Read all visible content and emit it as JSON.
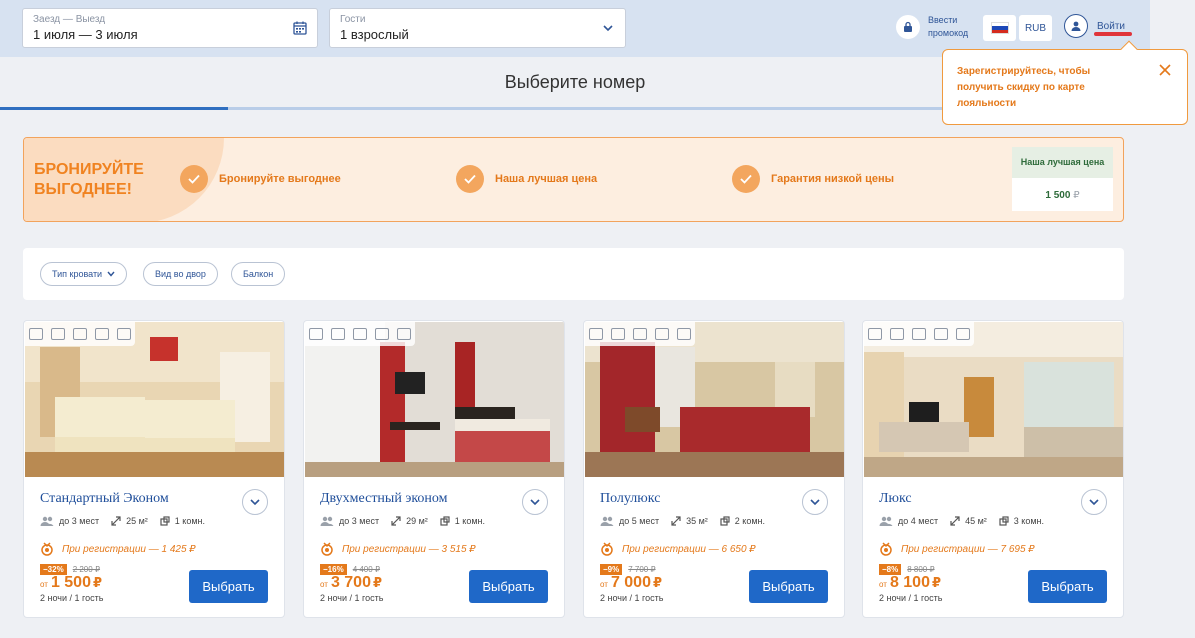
{
  "search": {
    "dates_label": "Заезд — Выезд",
    "dates_value": "1 июля — 3 июля",
    "guests_label": "Гости",
    "guests_value": "1 взрослый"
  },
  "header": {
    "promo_line1": "Ввести",
    "promo_line2": "промокод",
    "currency": "RUB",
    "login_label": "Войти"
  },
  "tooltip": {
    "text": "Зарегистрируйтесь, чтобы получить скидку по карте лояльности"
  },
  "page": {
    "title": "Выберите номер"
  },
  "banner": {
    "headline_line1": "БРОНИРУЙТЕ",
    "headline_line2": "ВЫГОДНЕЕ!",
    "items": [
      {
        "label": "Бронируйте выгоднее"
      },
      {
        "label": "Наша лучшая цена"
      },
      {
        "label": "Гарантия низкой цены"
      }
    ],
    "best_price_title": "Наша лучшая цена",
    "best_price_value": "1 500",
    "best_price_currency": "₽"
  },
  "filters": [
    {
      "label": "Тип кровати"
    },
    {
      "label": "Вид во двор"
    },
    {
      "label": "Балкон"
    }
  ],
  "rooms": [
    {
      "name": "Стандартный Эконом",
      "guests": "до 3 мест",
      "area": "25 м²",
      "rooms": "1 комн.",
      "reg_text": "При регистрации — 1 425 ₽",
      "discount": "−32%",
      "old_price": "2 200 ₽",
      "from": "от",
      "price": "1 500",
      "currency": "₽",
      "nights": "2 ночи / 1 гость",
      "button": "Выбрать"
    },
    {
      "name": "Двухместный эконом",
      "guests": "до 3 мест",
      "area": "29 м²",
      "rooms": "1 комн.",
      "reg_text": "При регистрации — 3 515 ₽",
      "discount": "−16%",
      "old_price": "4 400 ₽",
      "from": "от",
      "price": "3 700",
      "currency": "₽",
      "nights": "2 ночи / 1 гость",
      "button": "Выбрать"
    },
    {
      "name": "Полулюкс",
      "guests": "до 5 мест",
      "area": "35 м²",
      "rooms": "2 комн.",
      "reg_text": "При регистрации — 6 650 ₽",
      "discount": "−9%",
      "old_price": "7 700 ₽",
      "from": "от",
      "price": "7 000",
      "currency": "₽",
      "nights": "2 ночи / 1 гость",
      "button": "Выбрать"
    },
    {
      "name": "Люкс",
      "guests": "до 4 мест",
      "area": "45 м²",
      "rooms": "3 комн.",
      "reg_text": "При регистрации — 7 695 ₽",
      "discount": "−8%",
      "old_price": "8 800 ₽",
      "from": "от",
      "price": "8 100",
      "currency": "₽",
      "nights": "2 ночи / 1 гость",
      "button": "Выбрать"
    }
  ],
  "colors": {
    "accent_orange": "#e4791b",
    "primary_blue": "#1f68c8",
    "header_bg": "#d7e2f1"
  }
}
